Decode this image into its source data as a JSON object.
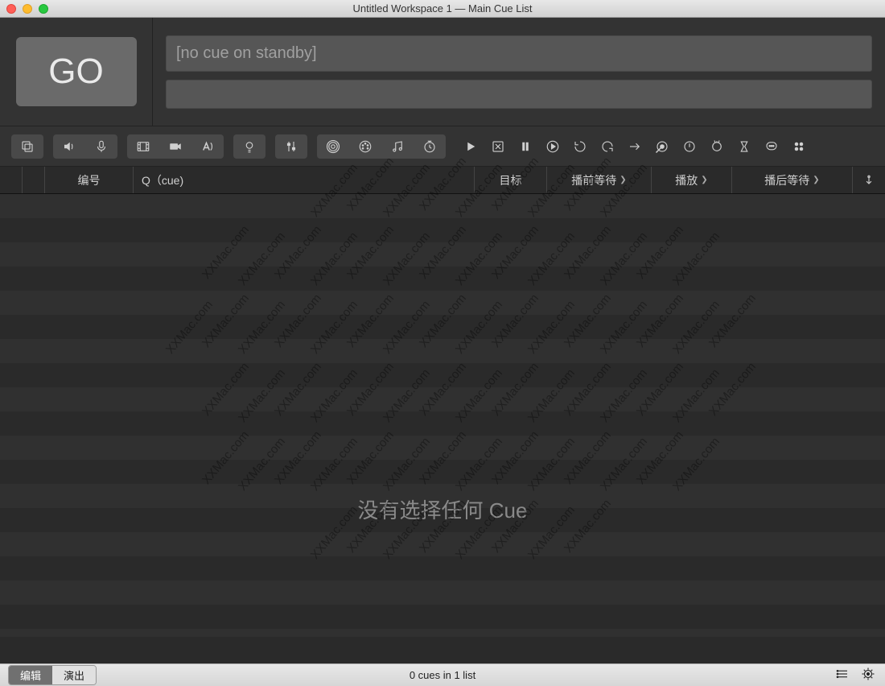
{
  "window": {
    "title": "Untitled Workspace 1 — Main Cue List"
  },
  "go_button": {
    "label": "GO"
  },
  "standby": {
    "placeholder": "[no cue on standby]"
  },
  "toolbar_groups": [
    {
      "id": "group",
      "icons": [
        "stack"
      ]
    },
    {
      "id": "audio",
      "icons": [
        "speaker",
        "mic"
      ]
    },
    {
      "id": "video",
      "icons": [
        "film",
        "camera",
        "text"
      ]
    },
    {
      "id": "light",
      "icons": [
        "bulb"
      ]
    },
    {
      "id": "fade",
      "icons": [
        "fader"
      ]
    },
    {
      "id": "network",
      "icons": [
        "target",
        "midi",
        "music",
        "clock"
      ]
    }
  ],
  "toolbar_right_icons": [
    "play",
    "panic",
    "pause",
    "resume",
    "undo-loop",
    "redo-loop",
    "goto",
    "arm",
    "power",
    "reset",
    "hourglass",
    "notes",
    "grid4"
  ],
  "columns": {
    "number": "编号",
    "q": "Q（cue)",
    "target": "目标",
    "prewait": "播前等待",
    "action": "播放",
    "postwait": "播后等待"
  },
  "empty_message": "没有选择任何 Cue",
  "watermark_text": "XXMac.com",
  "status": {
    "mode_edit": "编辑",
    "mode_show": "演出",
    "center": "0 cues in 1 list"
  }
}
